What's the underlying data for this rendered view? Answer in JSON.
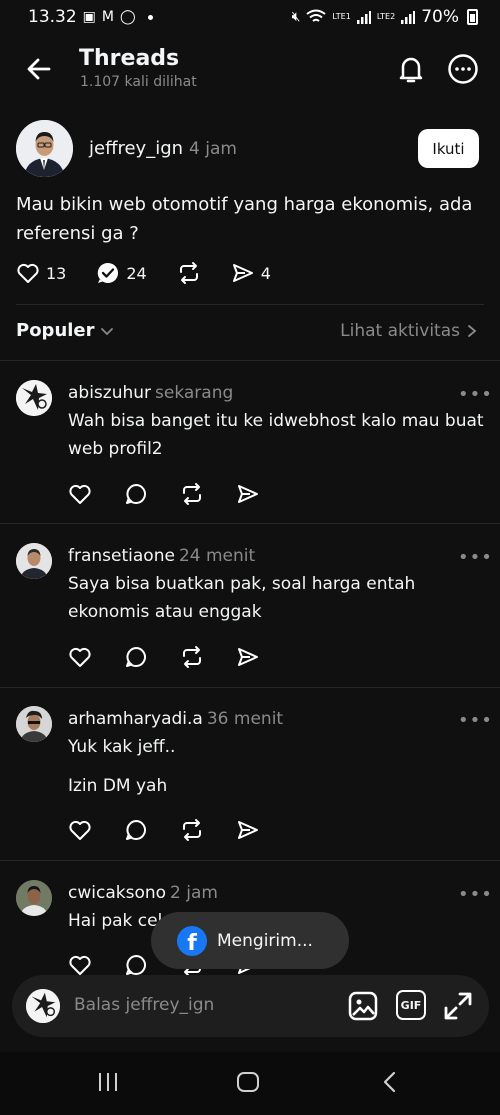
{
  "status_bar": {
    "time": "13.32",
    "battery": "70%",
    "sim1": "LTE1",
    "sim2": "LTE2",
    "icons": [
      "gallery-icon",
      "gmail-icon",
      "whatsapp-icon",
      "mute-icon",
      "wifi-icon",
      "signal-icon",
      "battery-icon"
    ]
  },
  "header": {
    "title": "Threads",
    "subtitle": "1.107 kali dilihat"
  },
  "post": {
    "username": "jeffrey_ign",
    "time": "4 jam",
    "follow_label": "Ikuti",
    "text": "Mau bikin web otomotif yang harga ekonomis, ada referensi ga ?",
    "likes": "13",
    "replies": "24",
    "shares": "4"
  },
  "sort": {
    "label": "Populer",
    "activity_label": "Lihat aktivitas"
  },
  "replies": [
    {
      "username": "abiszuhur",
      "time": "sekarang",
      "lines": [
        "Wah bisa banget itu ke idwebhost kalo mau buat web profil2"
      ]
    },
    {
      "username": "fransetiaone",
      "time": "24 menit",
      "lines": [
        "Saya bisa buatkan pak, soal harga entah ekonomis atau enggak"
      ]
    },
    {
      "username": "arhamharyadi.a",
      "time": "36 menit",
      "lines": [
        "Yuk kak jeff..",
        "Izin DM yah"
      ]
    },
    {
      "username": "cwicaksono",
      "time": "2 jam",
      "lines": [
        "Hai pak cek DM ya"
      ]
    }
  ],
  "toast": {
    "text": "Mengirim..."
  },
  "composer": {
    "placeholder": "Balas jeffrey_ign",
    "gif_label": "GIF"
  },
  "colors": {
    "background": "#101010",
    "text": "#f3f5f7",
    "muted": "#8a8a8a",
    "facebook_blue": "#1877f2"
  }
}
